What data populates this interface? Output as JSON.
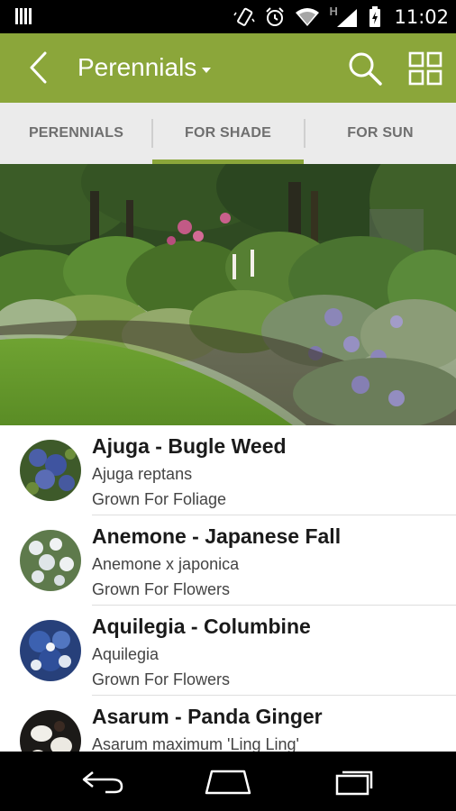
{
  "status_bar": {
    "time": "11:02",
    "network_label": "H",
    "icons": [
      "notification-icon",
      "vibrate-icon",
      "alarm-icon",
      "wifi-icon",
      "signal-icon",
      "battery-icon"
    ]
  },
  "action_bar": {
    "title": "Perennials",
    "icons": [
      "back-arrow-icon",
      "dropdown-caret-icon",
      "search-icon",
      "grid-view-icon"
    ],
    "color": "#8ba63a"
  },
  "tabs": [
    {
      "label": "PERENNIALS",
      "selected": false
    },
    {
      "label": "FOR SHADE",
      "selected": true
    },
    {
      "label": "FOR SUN",
      "selected": false
    }
  ],
  "plants": [
    {
      "name": "Ajuga - Bugle Weed",
      "scientific": "Ajuga reptans",
      "grown_for": "Grown For Foliage"
    },
    {
      "name": "Anemone - Japanese Fall",
      "scientific": "Anemone x japonica",
      "grown_for": "Grown For Flowers"
    },
    {
      "name": "Aquilegia - Columbine",
      "scientific": "Aquilegia",
      "grown_for": "Grown For Flowers"
    },
    {
      "name": "Asarum - Panda Ginger",
      "scientific": "Asarum maximum 'Ling Ling'",
      "grown_for": ""
    }
  ],
  "nav_bar": {
    "icons": [
      "back-icon",
      "home-icon",
      "recents-icon"
    ]
  }
}
